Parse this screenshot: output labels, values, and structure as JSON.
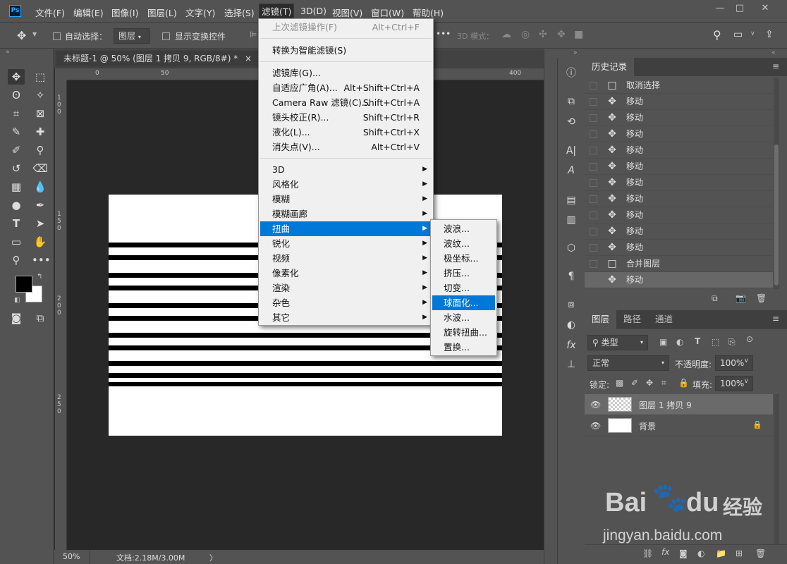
{
  "menubar": {
    "logo": "Ps",
    "items": [
      "文件(F)",
      "编辑(E)",
      "图像(I)",
      "图层(L)",
      "文字(Y)",
      "选择(S)",
      "滤镜(T)",
      "3D(D)",
      "视图(V)",
      "窗口(W)",
      "帮助(H)"
    ],
    "window_controls": [
      "—",
      "□",
      "✕"
    ]
  },
  "options_bar": {
    "auto_select_label": "自动选择：",
    "auto_select_target": "图层",
    "show_transform_label": "显示变换控件",
    "mode_3d_label": "3D 模式："
  },
  "document": {
    "tab_title": "未标题-1 @ 50% (图层 1 拷贝 9, RGB/8#) *",
    "tab_close": "×",
    "ruler_h_ticks": [
      "0",
      "50",
      "400"
    ],
    "ruler_v_ticks": [
      "1\n0\n0",
      "1\n5\n0",
      "2\n0\n0",
      "2\n5\n0"
    ],
    "zoom": "50%",
    "doc_info": "文档:2.18M/3.00M",
    "status_arrow": "〉"
  },
  "filter_menu": {
    "items": [
      {
        "label": "上次滤镜操作(F)",
        "shortcut": "Alt+Ctrl+F",
        "disabled": true
      },
      {
        "label": "转换为智能滤镜(S)",
        "shortcut": ""
      },
      {
        "label": "滤镜库(G)...",
        "shortcut": ""
      },
      {
        "label": "自适应广角(A)...",
        "shortcut": "Alt+Shift+Ctrl+A"
      },
      {
        "label": "Camera Raw 滤镜(C)...",
        "shortcut": "Shift+Ctrl+A"
      },
      {
        "label": "镜头校正(R)...",
        "shortcut": "Shift+Ctrl+R"
      },
      {
        "label": "液化(L)...",
        "shortcut": "Shift+Ctrl+X"
      },
      {
        "label": "消失点(V)...",
        "shortcut": "Alt+Ctrl+V"
      },
      {
        "label": "3D",
        "shortcut": ""
      },
      {
        "label": "风格化",
        "shortcut": ""
      },
      {
        "label": "模糊",
        "shortcut": ""
      },
      {
        "label": "模糊画廊",
        "shortcut": ""
      },
      {
        "label": "扭曲",
        "shortcut": ""
      },
      {
        "label": "锐化",
        "shortcut": ""
      },
      {
        "label": "视频",
        "shortcut": ""
      },
      {
        "label": "像素化",
        "shortcut": ""
      },
      {
        "label": "渲染",
        "shortcut": ""
      },
      {
        "label": "杂色",
        "shortcut": ""
      },
      {
        "label": "其它",
        "shortcut": ""
      }
    ],
    "highlighted": "扭曲",
    "submenu_arrow": "▶"
  },
  "distort_submenu": {
    "items": [
      "波浪...",
      "波纹...",
      "极坐标...",
      "挤压...",
      "切变...",
      "球面化...",
      "水波...",
      "旋转扭曲...",
      "置换..."
    ],
    "highlighted": "球面化..."
  },
  "history_panel": {
    "title": "历史记录",
    "entries": [
      {
        "label": "取消选择",
        "icon": "□"
      },
      {
        "label": "移动",
        "icon": "✥"
      },
      {
        "label": "移动",
        "icon": "✥"
      },
      {
        "label": "移动",
        "icon": "✥"
      },
      {
        "label": "移动",
        "icon": "✥"
      },
      {
        "label": "移动",
        "icon": "✥"
      },
      {
        "label": "移动",
        "icon": "✥"
      },
      {
        "label": "移动",
        "icon": "✥"
      },
      {
        "label": "移动",
        "icon": "✥"
      },
      {
        "label": "移动",
        "icon": "✥"
      },
      {
        "label": "移动",
        "icon": "✥"
      },
      {
        "label": "合并图层",
        "icon": "□"
      },
      {
        "label": "移动",
        "icon": "✥"
      }
    ]
  },
  "layers_panel": {
    "tabs": [
      "图层",
      "路径",
      "通道"
    ],
    "filter_kind": "类型",
    "blend_mode": "正常",
    "opacity_label": "不透明度:",
    "opacity_value": "100%",
    "lock_label": "锁定:",
    "fill_label": "填充:",
    "fill_value": "100%",
    "layers": [
      {
        "name": "图层 1 拷贝 9",
        "selected": true
      },
      {
        "name": "背景",
        "selected": false,
        "locked": true
      }
    ]
  },
  "watermark": {
    "brand": "Bai",
    "brand2": "du",
    "suffix": "经验",
    "url": "jingyan.baidu.com"
  }
}
